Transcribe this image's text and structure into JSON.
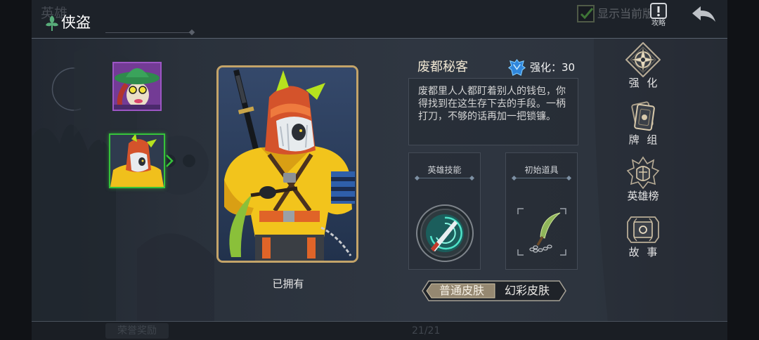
{
  "app": {
    "screen_title": "侠盗",
    "title_icon": "leaf-emblem-icon"
  },
  "top_bar": {
    "faded_tab_label": "英雄",
    "show_current_version": {
      "checked": true,
      "label": "显示当前版"
    },
    "guide_button": {
      "icon": "guide-alert-icon",
      "label": "攻略"
    },
    "back_button": {
      "icon": "back-arrow-icon"
    }
  },
  "hero_list": [
    {
      "portrait": "hero-portrait-witch-icon",
      "selected": false
    },
    {
      "portrait": "hero-portrait-rogue-icon",
      "selected": true
    }
  ],
  "skin_card": {
    "art": "rogue-skin-artwork",
    "status": "已拥有"
  },
  "skin_info": {
    "skin_name": "废都秘客",
    "enhance_icon": "blue-crest-icon",
    "enhance_label": "强化：30",
    "description": "废都里人人都盯着别人的钱包，你得找到在这生存下去的手段。一柄打刀，不够的话再加一把锁镰。"
  },
  "hero_skill": {
    "title": "英雄技能",
    "icon": "spiral-blade-skill-icon"
  },
  "starting_item": {
    "title": "初始道具",
    "icon": "chain-sickle-icon"
  },
  "skin_tabs": [
    {
      "label": "普通皮肤",
      "selected": true
    },
    {
      "label": "幻彩皮肤",
      "selected": false
    }
  ],
  "side_menu": [
    {
      "label": "强 化",
      "icon": "enhance-compass-icon"
    },
    {
      "label": "牌 组",
      "icon": "card-deck-icon"
    },
    {
      "label": "英雄榜",
      "icon": "hero-ranking-crest-icon"
    },
    {
      "label": "故 事",
      "icon": "story-book-icon"
    }
  ],
  "bottom_bar": {
    "faded_button_label": "荣誉奖励",
    "page_counter": "21/21"
  },
  "colors": {
    "title_leaf_green": "#58ad7a",
    "selected_frame_green": "#36c33b",
    "portrait_frame_purple": "#9c56c4",
    "card_frame_gold": "#c4a469",
    "enhance_crest_blue": "#2f86db",
    "panel_background": "#2f3641"
  }
}
